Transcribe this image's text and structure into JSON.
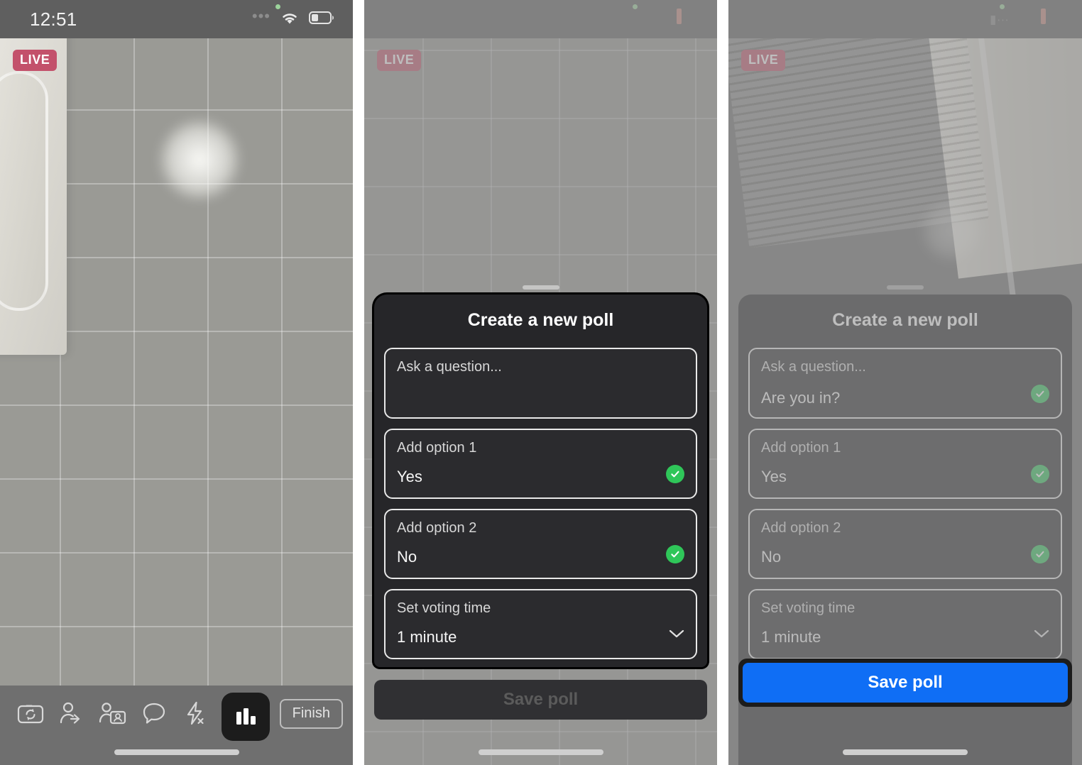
{
  "panels": [
    {
      "id": "panel-live-camera",
      "statusbar": {
        "clock": "12:51",
        "dots": "•••",
        "wifi_icon": "wifi-icon",
        "battery_icon": "battery-icon"
      },
      "live_badge": "LIVE",
      "toolbar": {
        "icons": [
          {
            "name": "switch-camera-icon",
            "label": "Switch camera"
          },
          {
            "name": "invite-person-icon",
            "label": "Invite"
          },
          {
            "name": "person-card-icon",
            "label": "Profile card"
          },
          {
            "name": "comment-bubble-icon",
            "label": "Comments"
          },
          {
            "name": "flash-off-icon",
            "label": "Flash off"
          },
          {
            "name": "poll-bar-chart-icon",
            "label": "Poll"
          }
        ],
        "finish_label": "Finish"
      }
    },
    {
      "id": "panel-create-poll-empty",
      "live_badge": "LIVE",
      "sheet": {
        "title": "Create a new poll",
        "question": {
          "label": "Ask a question...",
          "value": ""
        },
        "options": [
          {
            "label": "Add option 1",
            "value": "Yes",
            "validated": true
          },
          {
            "label": "Add option 2",
            "value": "No",
            "validated": true
          }
        ],
        "voting_time": {
          "label": "Set voting time",
          "value": "1 minute",
          "chevron_icon": "chevron-down-icon"
        },
        "save_label": "Save poll",
        "save_enabled": false
      }
    },
    {
      "id": "panel-create-poll-filled",
      "live_badge": "LIVE",
      "sheet": {
        "title": "Create a new poll",
        "question": {
          "label": "Ask a question...",
          "value": "Are you in?",
          "validated": true
        },
        "options": [
          {
            "label": "Add option 1",
            "value": "Yes",
            "validated": true
          },
          {
            "label": "Add option 2",
            "value": "No",
            "validated": true
          }
        ],
        "voting_time": {
          "label": "Set voting time",
          "value": "1 minute",
          "chevron_icon": "chevron-down-icon"
        },
        "save_label": "Save poll",
        "save_enabled": true
      }
    }
  ],
  "colors": {
    "sheet_bg": "#262629",
    "field_border": "#e9e9e9",
    "check_green": "#2fc659",
    "save_blue": "#0f6ef5",
    "live_red": "#c3516b",
    "highlight_ring": "#000000"
  }
}
